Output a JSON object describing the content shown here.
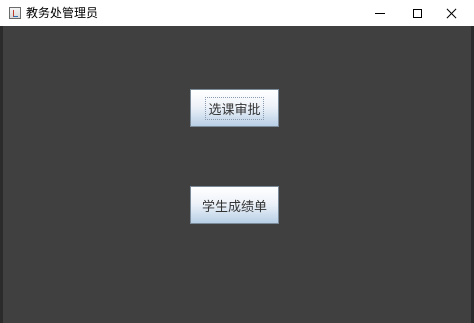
{
  "window": {
    "title": "教务处管理员",
    "controls": {
      "minimize_icon": "minimize-icon",
      "maximize_icon": "maximize-icon",
      "close_icon": "close-icon"
    }
  },
  "content": {
    "background_color": "#404040",
    "buttons": [
      {
        "label": "选课审批",
        "focused": true
      },
      {
        "label": "学生成绩单",
        "focused": false
      }
    ]
  }
}
